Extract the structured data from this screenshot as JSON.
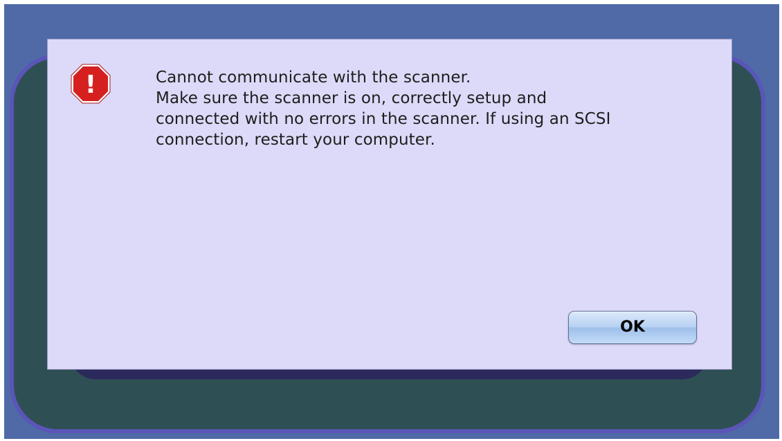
{
  "dialog": {
    "icon": "stop-alert-icon",
    "icon_glyph": "!",
    "message_lines": [
      "Cannot communicate with the scanner.",
      "Make sure the scanner is on, correctly setup and",
      "connected with no errors in the scanner. If using an SCSI",
      "connection, restart your computer."
    ],
    "ok_label": "OK"
  },
  "colors": {
    "background": "#4f6aa7",
    "dialog_bg": "#dcdaf8",
    "icon_red": "#d62020",
    "button_accent": "#b8d1f2"
  }
}
